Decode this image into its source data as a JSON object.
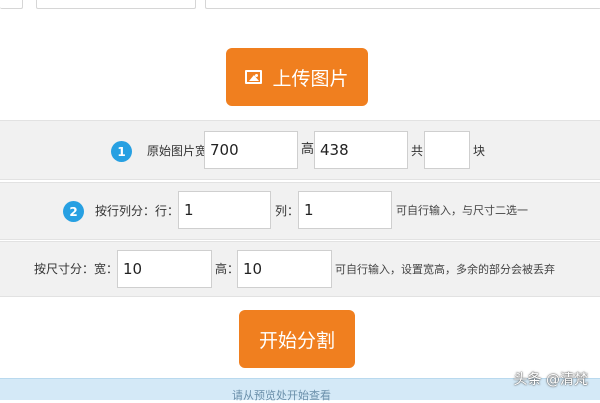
{
  "upload_button": {
    "label": "上传图片",
    "icon": "image-icon"
  },
  "original_size": {
    "step": "1",
    "width_label": "原始图片宽",
    "width_value": "700",
    "height_label": "高",
    "height_value": "438",
    "total_label": "共",
    "total_value": "",
    "unit_label": "块"
  },
  "split_by_count": {
    "step": "2",
    "label": "按行列分：行：",
    "rows_value": "1",
    "cols_label": "列：",
    "cols_value": "1",
    "hint": "可自行输入，与尺寸二选一"
  },
  "split_by_size": {
    "label": "按尺寸分：宽：",
    "width_value": "10",
    "height_label": "高：",
    "height_value": "10",
    "hint": "可自行输入，设置宽高，多余的部分会被丢弃"
  },
  "start_button": {
    "label": "开始分割"
  },
  "bottom_bar": {
    "text": "请从预览处开始查看"
  },
  "watermark": {
    "text": "头条 @清梵"
  },
  "colors": {
    "accent": "#f07f1f",
    "badge": "#27a0e2",
    "row_bg": "#f1f1f1",
    "bottom_bar": "#d4e9f7"
  }
}
